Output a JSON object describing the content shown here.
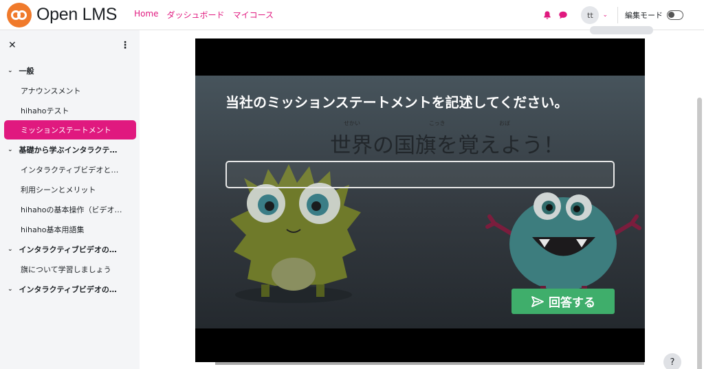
{
  "brand": {
    "name": "Open LMS"
  },
  "nav": {
    "home": "Home",
    "dashboard": "ダッシュボード",
    "my_courses": "マイコース"
  },
  "user": {
    "initials": "tt"
  },
  "edit_mode": {
    "label": "編集モード",
    "enabled": false
  },
  "sidebar": {
    "sections": [
      {
        "title": "一般",
        "items": [
          "アナウンスメント",
          "hihahoテスト",
          "ミッションステートメント"
        ]
      },
      {
        "title": "基礎から学ぶインタラクテ…",
        "items": [
          "インタラクティブビデオと…",
          "利用シーンとメリット",
          "hihahoの基本操作（ビデオ…",
          "hihaho基本用語集"
        ]
      },
      {
        "title": "インタラクティブビデオの…",
        "items": [
          "旗について学習しましょう"
        ]
      },
      {
        "title": "インタラクティブビデオの…",
        "items": []
      }
    ],
    "active_item": "ミッションステートメント"
  },
  "video": {
    "background_title": "世界の国旗を覚えよう！",
    "ruby": {
      "sekai": "せかい",
      "kokki": "こっき",
      "oboe": "おぼ"
    },
    "question": "当社のミッションステートメントを記述してください。",
    "answer_value": "",
    "submit_label": "回答する"
  },
  "help": {
    "label": "?"
  },
  "colors": {
    "accent": "#e0197f",
    "logo": "#f07a2b",
    "submit": "#3fae6b"
  }
}
